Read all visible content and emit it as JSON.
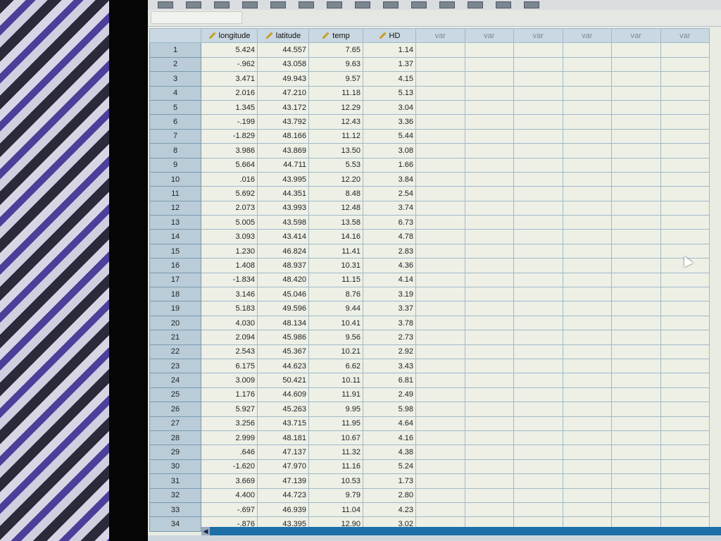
{
  "columns": [
    "longitude",
    "latitude",
    "temp",
    "HD"
  ],
  "var_columns": [
    "var",
    "var",
    "var",
    "var",
    "var",
    "var"
  ],
  "rows": [
    [
      "5.424",
      "44.557",
      "7.65",
      "1.14"
    ],
    [
      "-.962",
      "43.058",
      "9.63",
      "1.37"
    ],
    [
      "3.471",
      "49.943",
      "9.57",
      "4.15"
    ],
    [
      "2.016",
      "47.210",
      "11.18",
      "5.13"
    ],
    [
      "1.345",
      "43.172",
      "12.29",
      "3.04"
    ],
    [
      "-.199",
      "43.792",
      "12.43",
      "3.36"
    ],
    [
      "-1.829",
      "48.166",
      "11.12",
      "5.44"
    ],
    [
      "3.986",
      "43.869",
      "13.50",
      "3.08"
    ],
    [
      "5.664",
      "44.711",
      "5.53",
      "1.66"
    ],
    [
      ".016",
      "43.995",
      "12.20",
      "3.84"
    ],
    [
      "5.692",
      "44.351",
      "8.48",
      "2.54"
    ],
    [
      "2.073",
      "43.993",
      "12.48",
      "3.74"
    ],
    [
      "5.005",
      "43.598",
      "13.58",
      "6.73"
    ],
    [
      "3.093",
      "43.414",
      "14.16",
      "4.78"
    ],
    [
      "1.230",
      "46.824",
      "11.41",
      "2.83"
    ],
    [
      "1.408",
      "48.937",
      "10.31",
      "4.36"
    ],
    [
      "-1.834",
      "48.420",
      "11.15",
      "4.14"
    ],
    [
      "3.146",
      "45.046",
      "8.76",
      "3.19"
    ],
    [
      "5.183",
      "49.596",
      "9.44",
      "3.37"
    ],
    [
      "4.030",
      "48.134",
      "10.41",
      "3.78"
    ],
    [
      "2.094",
      "45.986",
      "9.56",
      "2.73"
    ],
    [
      "2.543",
      "45.367",
      "10.21",
      "2.92"
    ],
    [
      "6.175",
      "44.623",
      "6.62",
      "3.43"
    ],
    [
      "3.009",
      "50.421",
      "10.11",
      "6.81"
    ],
    [
      "1.176",
      "44.609",
      "11.91",
      "2.49"
    ],
    [
      "5.927",
      "45.263",
      "9.95",
      "5.98"
    ],
    [
      "3.256",
      "43.715",
      "11.95",
      "4.64"
    ],
    [
      "2.999",
      "48.181",
      "10.67",
      "4.16"
    ],
    [
      ".646",
      "47.137",
      "11.32",
      "4.38"
    ],
    [
      "-1.620",
      "47.970",
      "11.16",
      "5.24"
    ],
    [
      "3.669",
      "47.139",
      "10.53",
      "1.73"
    ],
    [
      "4.400",
      "44.723",
      "9.79",
      "2.80"
    ],
    [
      "-.697",
      "46.939",
      "11.04",
      "4.23"
    ],
    [
      "-.876",
      "43.395",
      "12.90",
      "3.02"
    ]
  ],
  "scroll_left_icon": "◀"
}
